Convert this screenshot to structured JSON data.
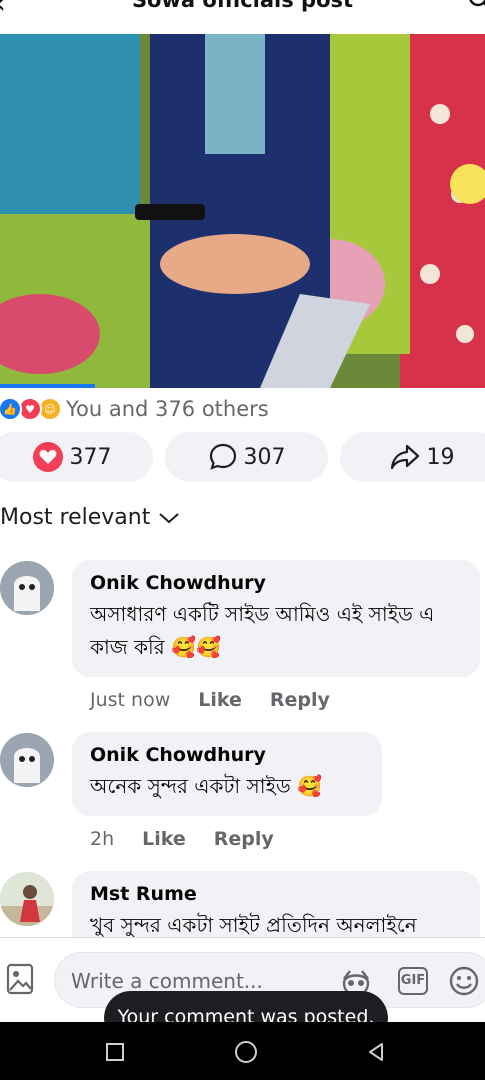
{
  "header": {
    "title": "Sowa officials post",
    "back_icon": "back-arrow-icon",
    "search_icon": "search-icon"
  },
  "reactions": {
    "icons": [
      "like-icon",
      "love-icon",
      "haha-icon"
    ],
    "summary": "You and 376 others"
  },
  "stats": {
    "likes": "377",
    "comments": "307",
    "shares": "19"
  },
  "sort": {
    "label": "Most relevant"
  },
  "comments": [
    {
      "name": "Onik Chowdhury",
      "text": "অসাধারণ একটি সাইড আমিও এই সাইড এ কাজ করি 🥰🥰",
      "time": "Just now",
      "like": "Like",
      "reply": "Reply"
    },
    {
      "name": "Onik Chowdhury",
      "text": "অনেক সুন্দর একটা সাইড 🥰",
      "time": "2h",
      "like": "Like",
      "reply": "Reply"
    },
    {
      "name": "Mst Rume",
      "text": "খুব সুন্দর একটা সাইট প্রতিদিন অনলাইনে"
    }
  ],
  "composer": {
    "placeholder": "Write a comment..."
  },
  "toast": {
    "text": "Your comment was posted."
  },
  "colors": {
    "accent": "#1877f2",
    "love": "#f33e58",
    "bubble": "#f0f2f5",
    "muted": "#65676b"
  }
}
